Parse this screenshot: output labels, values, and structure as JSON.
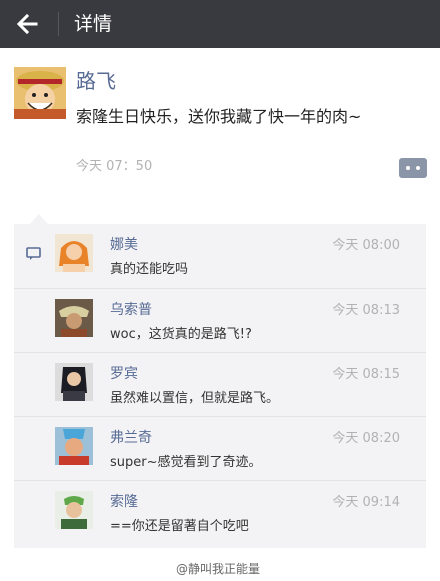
{
  "header": {
    "title": "详情"
  },
  "post": {
    "author": "路飞",
    "text": "索隆生日快乐，送你我藏了快一年的肉~",
    "time": "今天  07：50"
  },
  "comments": [
    {
      "name": "娜美",
      "time": "今天 08:00",
      "text": "真的还能吃吗"
    },
    {
      "name": "乌索普",
      "time": "今天 08:13",
      "text": "woc，这货真的是路飞!?"
    },
    {
      "name": "罗宾",
      "time": "今天 08:15",
      "text": "虽然难以置信，但就是路飞。"
    },
    {
      "name": "弗兰奇",
      "time": "今天 08:20",
      "text": "super~感觉看到了奇迹。"
    },
    {
      "name": "索隆",
      "time": "今天 09:14",
      "text": "==你还是留著自个吃吧"
    }
  ],
  "watermark": "@静叫我正能量"
}
